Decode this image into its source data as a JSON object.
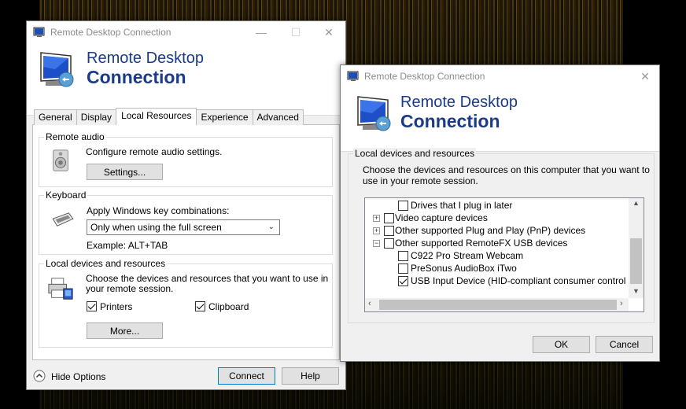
{
  "app_title": "Remote Desktop Connection",
  "banner": {
    "line1": "Remote Desktop",
    "line2": "Connection"
  },
  "main": {
    "tabs": [
      "General",
      "Display",
      "Local Resources",
      "Experience",
      "Advanced"
    ],
    "active_tab": "Local Resources",
    "remote_audio": {
      "label": "Remote audio",
      "description": "Configure remote audio settings.",
      "settings_button": "Settings..."
    },
    "keyboard": {
      "label": "Keyboard",
      "description": "Apply Windows key combinations:",
      "selected": "Only when using the full screen",
      "example": "Example: ALT+TAB"
    },
    "local_devices": {
      "label": "Local devices and resources",
      "description1": "Choose the devices and resources that you want to use in",
      "description2": "your remote session.",
      "printers": "Printers",
      "printers_checked": true,
      "clipboard": "Clipboard",
      "clipboard_checked": true,
      "more_button": "More..."
    },
    "footer": {
      "hide_options": "Hide Options",
      "connect_button": "Connect",
      "help_button": "Help"
    }
  },
  "dialog": {
    "group_label": "Local devices and resources",
    "description1": "Choose the devices and resources on this computer that you want to",
    "description2": "use in your remote session.",
    "tree": [
      {
        "label": "Drives that I plug in later",
        "checked": false,
        "expander": null
      },
      {
        "label": "Video capture devices",
        "checked": false,
        "expander": "+"
      },
      {
        "label": "Other supported Plug and Play (PnP) devices",
        "checked": false,
        "expander": "+"
      },
      {
        "label": "Other supported RemoteFX USB devices",
        "checked": false,
        "expander": "-"
      },
      {
        "label": "C922 Pro Stream Webcam",
        "checked": false,
        "expander": null
      },
      {
        "label": "PreSonus AudioBox iTwo",
        "checked": false,
        "expander": null
      },
      {
        "label": "USB Input Device (HID-compliant consumer control device",
        "checked": true,
        "expander": null
      }
    ],
    "ok_button": "OK",
    "cancel_button": "Cancel"
  },
  "icons": {
    "window": "rdc-monitor-icon",
    "audio": "speaker-icon",
    "keyboard": "keyboard-icon",
    "devices": "printer-devices-icon",
    "hide_options": "chevron-up-circle-icon"
  }
}
